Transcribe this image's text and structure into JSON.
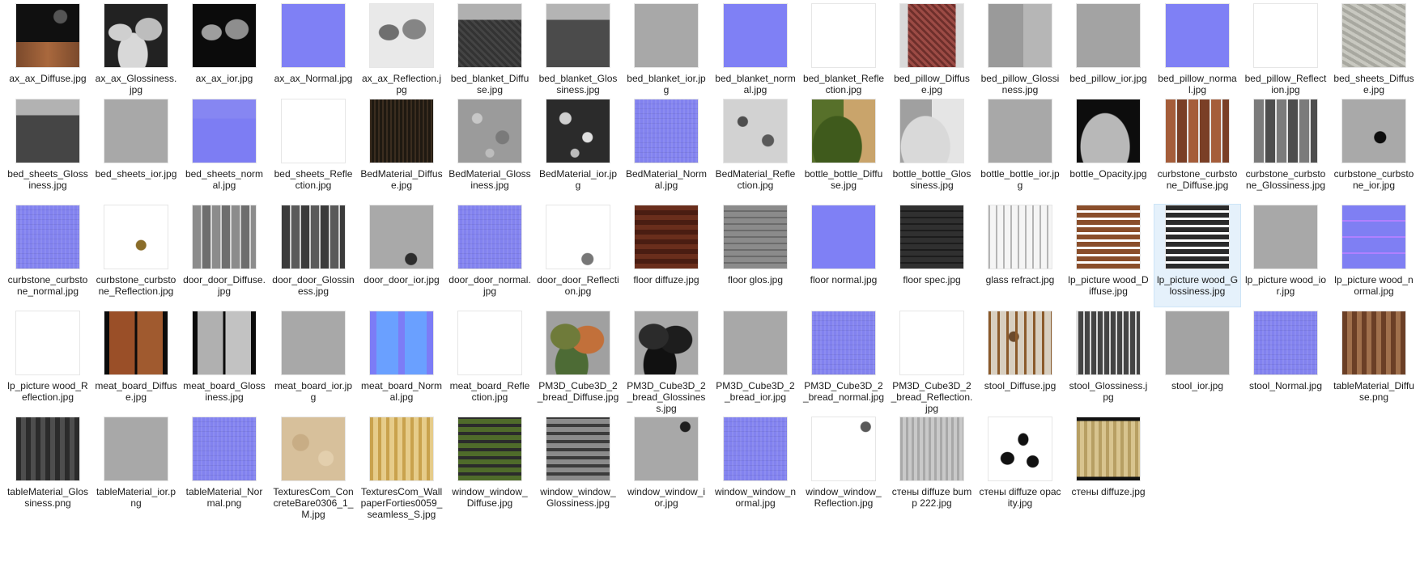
{
  "folder": {
    "files": [
      {
        "name": "ax_ax_Diffuse.jpg",
        "thumb": "atlas dark with wood",
        "selected": false
      },
      {
        "name": "ax_ax_Glossiness.jpg",
        "thumb": "atlas bw",
        "selected": false
      },
      {
        "name": "ax_ax_ior.jpg",
        "thumb": "atlas dark",
        "selected": false
      },
      {
        "name": "ax_ax_Normal.jpg",
        "thumb": "normal blue",
        "selected": false
      },
      {
        "name": "ax_ax_Reflection.jpg",
        "thumb": "atlas light",
        "selected": false
      },
      {
        "name": "bed_blanket_Diffuse.jpg",
        "thumb": "blanket dark",
        "selected": false
      },
      {
        "name": "bed_blanket_Glossiness.jpg",
        "thumb": "blanket dark",
        "selected": false
      },
      {
        "name": "bed_blanket_ior.jpg",
        "thumb": "gray",
        "selected": false
      },
      {
        "name": "bed_blanket_normal.jpg",
        "thumb": "normal blue",
        "selected": false
      },
      {
        "name": "bed_blanket_Reflection.jpg",
        "thumb": "white",
        "selected": false
      },
      {
        "name": "bed_pillow_Diffuse.jpg",
        "thumb": "pillow pattern",
        "selected": false
      },
      {
        "name": "bed_pillow_Glossiness.jpg",
        "thumb": "gray split",
        "selected": false
      },
      {
        "name": "bed_pillow_ior.jpg",
        "thumb": "gray",
        "selected": false
      },
      {
        "name": "bed_pillow_normal.jpg",
        "thumb": "normal blue",
        "selected": false
      },
      {
        "name": "bed_pillow_Reflection.jpg",
        "thumb": "white",
        "selected": false
      },
      {
        "name": "bed_sheets_Diffuse.jpg",
        "thumb": "sheets light",
        "selected": false
      },
      {
        "name": "bed_sheets_Glossiness.jpg",
        "thumb": "sheets dark",
        "selected": false
      },
      {
        "name": "bed_sheets_ior.jpg",
        "thumb": "gray",
        "selected": false
      },
      {
        "name": "bed_sheets_normal.jpg",
        "thumb": "normal blue",
        "selected": false
      },
      {
        "name": "bed_sheets_Reflection.jpg",
        "thumb": "white",
        "selected": false
      },
      {
        "name": "BedMaterial_Diffuse.jpg",
        "thumb": "dark wood",
        "selected": false
      },
      {
        "name": "BedMaterial_Glossiness.jpg",
        "thumb": "concrete",
        "selected": false
      },
      {
        "name": "BedMaterial_ior.jpg",
        "thumb": "concrete dark",
        "selected": false
      },
      {
        "name": "BedMaterial_Normal.jpg",
        "thumb": "normal noise",
        "selected": false
      },
      {
        "name": "BedMaterial_Reflection.jpg",
        "thumb": "concrete light",
        "selected": false
      },
      {
        "name": "bottle_bottle_Diffuse.jpg",
        "thumb": "bottle diffuse",
        "selected": false
      },
      {
        "name": "bottle_bottle_Glossiness.jpg",
        "thumb": "bottle gloss",
        "selected": false
      },
      {
        "name": "bottle_bottle_ior.jpg",
        "thumb": "gray",
        "selected": false
      },
      {
        "name": "bottle_Opacity.jpg",
        "thumb": "bottle opacity",
        "selected": false
      },
      {
        "name": "curbstone_curbstone_Diffuse.jpg",
        "thumb": "curbstone diffuse",
        "selected": false
      },
      {
        "name": "curbstone_curbstone_Glossiness.jpg",
        "thumb": "curbstone gloss",
        "selected": false
      },
      {
        "name": "curbstone_curbstone_ior.jpg",
        "thumb": "gray with dots",
        "selected": false
      },
      {
        "name": "curbstone_curbstone_normal.jpg",
        "thumb": "normal blue",
        "selected": false
      },
      {
        "name": "curbstone_curbstone_Reflection.jpg",
        "thumb": "white with dots",
        "selected": false
      },
      {
        "name": "door_door_Diffuse.jpg",
        "thumb": "door diffuse",
        "selected": false
      },
      {
        "name": "door_door_Glossiness.jpg",
        "thumb": "door gloss",
        "selected": false
      },
      {
        "name": "door_door_ior.jpg",
        "thumb": "door ior",
        "selected": false
      },
      {
        "name": "door_door_normal.jpg",
        "thumb": "normal noise",
        "selected": false
      },
      {
        "name": "door_door_Reflection.jpg",
        "thumb": "door reflection",
        "selected": false
      },
      {
        "name": "floor diffuze.jpg",
        "thumb": "floor wood",
        "selected": false
      },
      {
        "name": "floor glos.jpg",
        "thumb": "floor gray",
        "selected": false
      },
      {
        "name": "floor normal.jpg",
        "thumb": "normal blue",
        "selected": false
      },
      {
        "name": "floor spec.jpg",
        "thumb": "floor dark",
        "selected": false
      },
      {
        "name": "glass refract.jpg",
        "thumb": "glass",
        "selected": false
      },
      {
        "name": "lp_picture wood_Diffuse.jpg",
        "thumb": "lp diffuse",
        "selected": false
      },
      {
        "name": "lp_picture wood_Glossiness.jpg",
        "thumb": "lp gloss",
        "selected": true
      },
      {
        "name": "lp_picture wood_ior.jpg",
        "thumb": "gray",
        "selected": false
      },
      {
        "name": "lp_picture wood_normal.jpg",
        "thumb": "lp normal",
        "selected": false
      },
      {
        "name": "lp_picture wood_Reflection.jpg",
        "thumb": "white",
        "selected": false
      },
      {
        "name": "meat_board_Diffuse.jpg",
        "thumb": "board diffuse",
        "selected": false
      },
      {
        "name": "meat_board_Glossiness.jpg",
        "thumb": "board gloss",
        "selected": false
      },
      {
        "name": "meat_board_ior.jpg",
        "thumb": "gray",
        "selected": false
      },
      {
        "name": "meat_board_Normal.jpg",
        "thumb": "board normal",
        "selected": false
      },
      {
        "name": "meat_board_Reflection.jpg",
        "thumb": "white",
        "selected": false
      },
      {
        "name": "PM3D_Cube3D_2_bread_Diffuse.jpg",
        "thumb": "bread diffuse",
        "selected": false
      },
      {
        "name": "PM3D_Cube3D_2_bread_Glossiness.jpg",
        "thumb": "bread gloss",
        "selected": false
      },
      {
        "name": "PM3D_Cube3D_2_bread_ior.jpg",
        "thumb": "gray",
        "selected": false
      },
      {
        "name": "PM3D_Cube3D_2_bread_normal.jpg",
        "thumb": "normal noise",
        "selected": false
      },
      {
        "name": "PM3D_Cube3D_2_bread_Reflection.jpg",
        "thumb": "white",
        "selected": false
      },
      {
        "name": "stool_Diffuse.jpg",
        "thumb": "stool diffuse",
        "selected": false
      },
      {
        "name": "stool_Glossiness.jpg",
        "thumb": "stool gloss",
        "selected": false
      },
      {
        "name": "stool_ior.jpg",
        "thumb": "gray",
        "selected": false
      },
      {
        "name": "stool_Normal.jpg",
        "thumb": "normal noise",
        "selected": false
      },
      {
        "name": "tableMaterial_Diffuse.png",
        "thumb": "table diffuse",
        "selected": false
      },
      {
        "name": "tableMaterial_Glossiness.png",
        "thumb": "table gloss",
        "selected": false
      },
      {
        "name": "tableMaterial_ior.png",
        "thumb": "gray",
        "selected": false
      },
      {
        "name": "tableMaterial_Normal.png",
        "thumb": "normal noise",
        "selected": false
      },
      {
        "name": "TexturesCom_ConcreteBare0306_1_M.jpg",
        "thumb": "concrete beige",
        "selected": false
      },
      {
        "name": "TexturesCom_WallpaperForties0059_seamless_S.jpg",
        "thumb": "wallpaper",
        "selected": false
      },
      {
        "name": "window_window_Diffuse.jpg",
        "thumb": "window diffuse",
        "selected": false
      },
      {
        "name": "window_window_Glossiness.jpg",
        "thumb": "window gloss",
        "selected": false
      },
      {
        "name": "window_window_ior.jpg",
        "thumb": "window ior",
        "selected": false
      },
      {
        "name": "window_window_normal.jpg",
        "thumb": "normal noise",
        "selected": false
      },
      {
        "name": "window_window_Reflection.jpg",
        "thumb": "window reflection",
        "selected": false
      },
      {
        "name": "стены diffuze bump 222.jpg",
        "thumb": "walls bump",
        "selected": false
      },
      {
        "name": "стены diffuze opacity.jpg",
        "thumb": "walls opacity",
        "selected": false
      },
      {
        "name": "стены diffuze.jpg",
        "thumb": "walls diffuse",
        "selected": false
      }
    ]
  }
}
